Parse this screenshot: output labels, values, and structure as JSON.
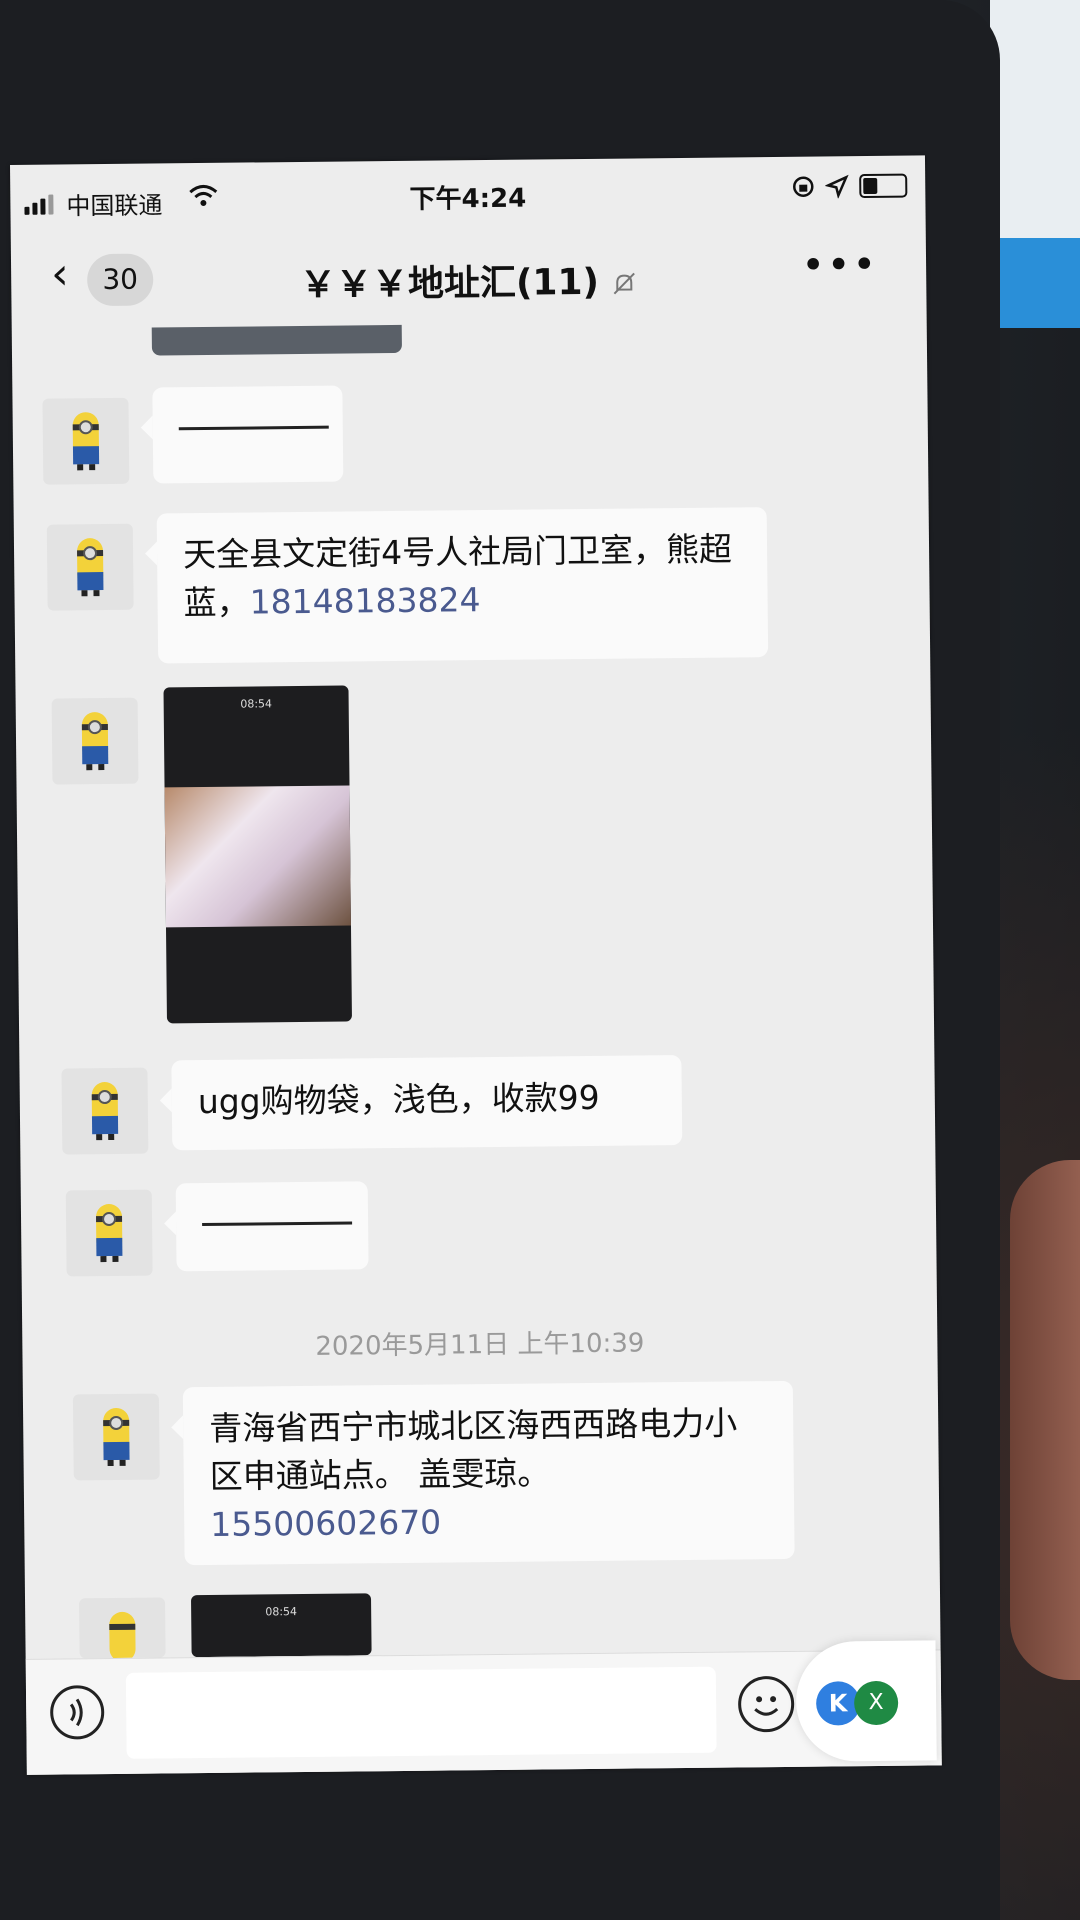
{
  "status_bar": {
    "carrier": "中国联通",
    "time": "下午4:24"
  },
  "nav": {
    "back_count": "30",
    "title": "￥￥￥地址汇(11)"
  },
  "messages": {
    "m1_text": "",
    "m2_text": "天全县文定街4号人社局门卫室，熊超蓝，",
    "m2_phone": "18148183824",
    "m4_text": "ugg购物袋，浅色，收款99",
    "timestamp": "2020年5月11日 上午10:39",
    "m6_text": "青海省西宁市城北区海西西路电力小区申通站点。 盖雯琼。",
    "m6_phone": "15500602670"
  },
  "thumbnail": {
    "top_time": "08:54"
  },
  "floating_widget": {
    "left_label": "K",
    "right_label": "X"
  },
  "colors": {
    "chat_background": "#ededed",
    "bubble": "#fafafa",
    "link": "#4a5a8f"
  }
}
